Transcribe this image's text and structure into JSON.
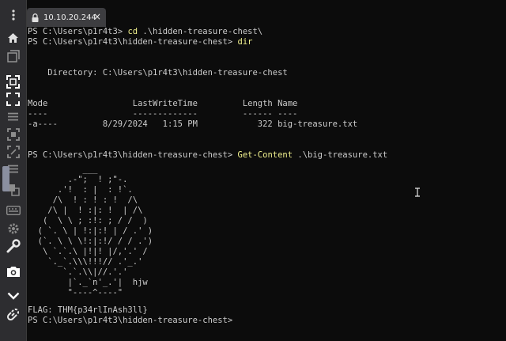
{
  "tab": {
    "title": "10.10.20.244",
    "close": "×"
  },
  "sidebar": {
    "icons": [
      "more-icon",
      "home-icon",
      "new-window-icon",
      "fullscreen-icon",
      "fit-screen-icon",
      "menu-icon",
      "scale-icon",
      "resize-icon",
      "list-icon",
      "multi-window-icon",
      "keyboard-icon",
      "settings-icon",
      "tools-icon",
      "camera-icon",
      "chevron-down-icon",
      "reconnect-icon"
    ]
  },
  "terminal": {
    "cmd1": {
      "prompt": "PS C:\\Users\\p1r4t3> ",
      "command": "cd",
      "args": " .\\hidden-treasure-chest\\"
    },
    "cmd2": {
      "prompt": "PS C:\\Users\\p1r4t3\\hidden-treasure-chest> ",
      "command": "dir",
      "args": ""
    },
    "directory_line": "    Directory: C:\\Users\\p1r4t3\\hidden-treasure-chest",
    "table_header": "Mode                 LastWriteTime         Length Name",
    "table_underline": "----                 -------------         ------ ----",
    "table_row": "-a----         8/29/2024   1:15 PM            322 big-treasure.txt",
    "cmd3": {
      "prompt": "PS C:\\Users\\p1r4t3\\hidden-treasure-chest> ",
      "command": "Get-Content",
      "args": " .\\big-treasure.txt"
    },
    "ascii_art": "           ___\n        .-\";  ! ;\"-.\n      .'!  : |  : !`.\n     /\\  ! : ! : !  /\\\n    /\\ |  ! :|: !  | /\\\n   (  \\ \\ ; :!: ; / /  )\n  ( `. \\ | !:|:! | / .' )\n  (`. \\ \\ \\!:|:!/ / / .')\n   \\ `.`.\\ |!|! |/,'.' /\n    `._`.\\\\\\!!!// .'_.'\n       `.`.\\\\|//.'.'\n        |`._`n'_.'|  hjw\n        \"----^----\"",
    "flag_line": "FLAG: THM{p34rlInAsh3ll}",
    "final_prompt": "PS C:\\Users\\p1r4t3\\hidden-treasure-chest>"
  }
}
